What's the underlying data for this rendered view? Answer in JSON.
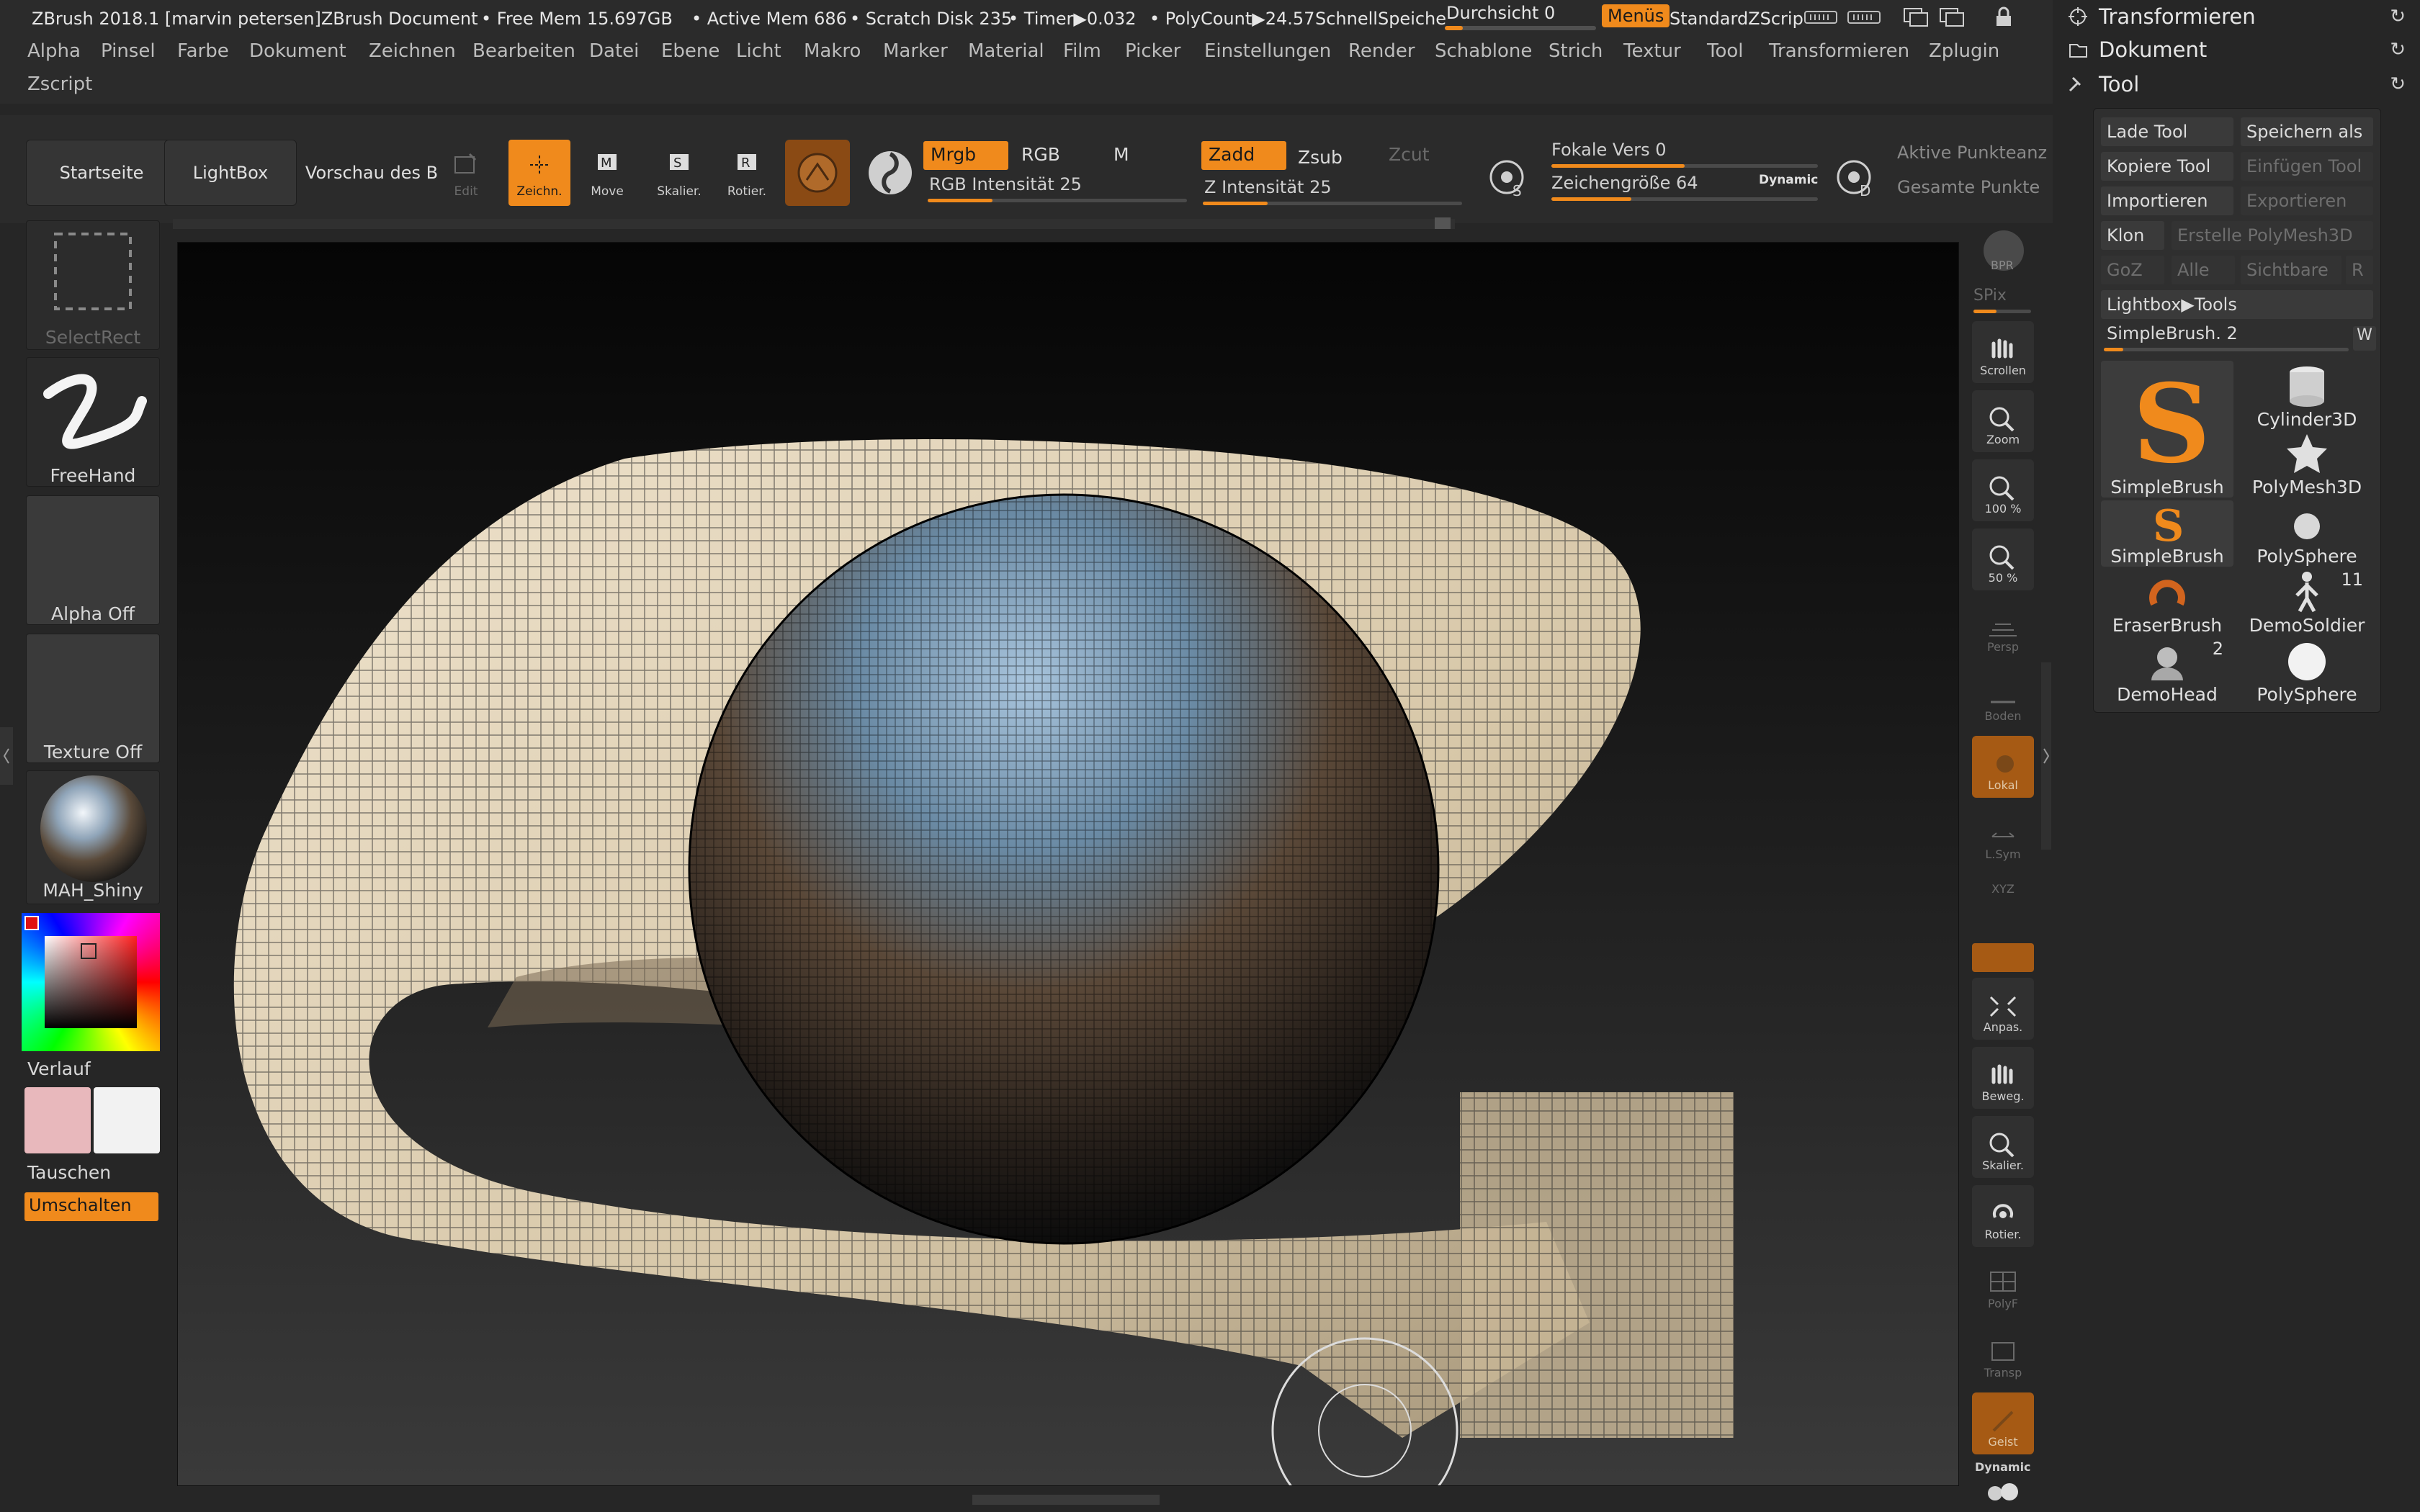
{
  "titlebar": {
    "title": "ZBrush 2018.1 [marvin petersen]ZBrush Document",
    "free_mem": "• Free Mem 15.697GB",
    "active_mem": "• Active Mem 686",
    "scratch": "• Scratch Disk 235",
    "timer": "• Timer▶0.032",
    "polycount": "• PolyCount▶24.57",
    "quicksave": "SchnellSpeiche",
    "opacity_label": "Durchsicht 0",
    "menus_label": "Menüs",
    "script_label": "StandardZScrip"
  },
  "menubar": {
    "items": [
      "Alpha",
      "Pinsel",
      "Farbe",
      "Dokument",
      "Zeichnen",
      "Bearbeiten",
      "Datei",
      "Ebene",
      "Licht",
      "Makro",
      "Marker",
      "Material",
      "Film",
      "Picker",
      "Einstellungen",
      "Render",
      "Schablone",
      "Strich",
      "Textur",
      "Tool",
      "Transformieren",
      "Zplugin"
    ],
    "second_row": "Zscript"
  },
  "shelf": {
    "home": "Startseite",
    "lightbox": "LightBox",
    "preview": "Vorschau des B",
    "tools": [
      {
        "label": "Edit",
        "icon": "edit-icon",
        "active": false,
        "dim": true
      },
      {
        "label": "Zeichn.",
        "icon": "draw-icon",
        "active": true,
        "dim": false
      },
      {
        "label": "Move",
        "icon": "move-icon",
        "active": false,
        "dim": false
      },
      {
        "label": "Skalier.",
        "icon": "scale-icon",
        "active": false,
        "dim": false
      },
      {
        "label": "Rotier.",
        "icon": "rotate-icon",
        "active": false,
        "dim": false
      }
    ],
    "toggles": {
      "mrgb": "Mrgb",
      "rgb": "RGB",
      "m": "M",
      "zadd": "Zadd",
      "zsub": "Zsub",
      "zcut": "Zcut"
    },
    "rgb_intensity": {
      "label": "RGB Intensität 25",
      "value": 0.25
    },
    "z_intensity": {
      "label": "Z Intensität 25",
      "value": 0.25
    },
    "focal": {
      "label": "Fokale Vers 0",
      "value": 0.5
    },
    "draw_size": {
      "label": "Zeichengröße 64",
      "value": 0.3
    },
    "dynamic": "Dynamic",
    "active_points": "Aktive Punkteanz",
    "total_points": "Gesamte Punkte"
  },
  "left_tray": {
    "select_rect": "SelectRect",
    "freehand": "FreeHand",
    "alpha": "Alpha Off",
    "texture": "Texture Off",
    "material": "MAH_Shiny",
    "gradient": "Verlauf",
    "swap": "Tauschen",
    "toggle": "Umschalten",
    "main_color": "#e8b8bc",
    "secondary_color": "#f2f2f2"
  },
  "right_strip": {
    "bpr": "BPR",
    "spix": "SPix",
    "buttons": [
      "Scrollen",
      "Zoom",
      "100 %",
      "50 %",
      "Persp",
      "Boden",
      "Lokal",
      "L.Sym",
      "XYZ",
      "Anpas.",
      "Beweg.",
      "Skalier.",
      "Rotier.",
      "PolyF",
      "Transp",
      "Geist"
    ],
    "dynamic": "Dynamic"
  },
  "palette": {
    "transform": "Transformieren",
    "document": "Dokument",
    "tool": "Tool",
    "buttons": {
      "load": "Lade Tool",
      "save_as": "Speichern als",
      "copy": "Kopiere Tool",
      "paste": "Einfügen Tool",
      "import": "Importieren",
      "export": "Exportieren",
      "clone": "Klon",
      "make_polymesh": "Erstelle PolyMesh3D",
      "goz": "GoZ",
      "all": "Alle",
      "visible": "Sichtbare",
      "r": "R",
      "lightbox_tools": "Lightbox▶Tools"
    },
    "current_tool": {
      "label": "SimpleBrush. 2",
      "w": "W"
    },
    "tools": [
      {
        "name": "SimpleBrush",
        "count": ""
      },
      {
        "name": "Cylinder3D",
        "count": ""
      },
      {
        "name": "PolyMesh3D",
        "count": ""
      },
      {
        "name": "SimpleBrush",
        "count": ""
      },
      {
        "name": "PolySphere",
        "count": ""
      },
      {
        "name": "EraserBrush",
        "count": ""
      },
      {
        "name": "DemoSoldier",
        "count": "11"
      },
      {
        "name": "DemoHead",
        "count": "2"
      },
      {
        "name": "PolySphere",
        "count": ""
      }
    ]
  }
}
